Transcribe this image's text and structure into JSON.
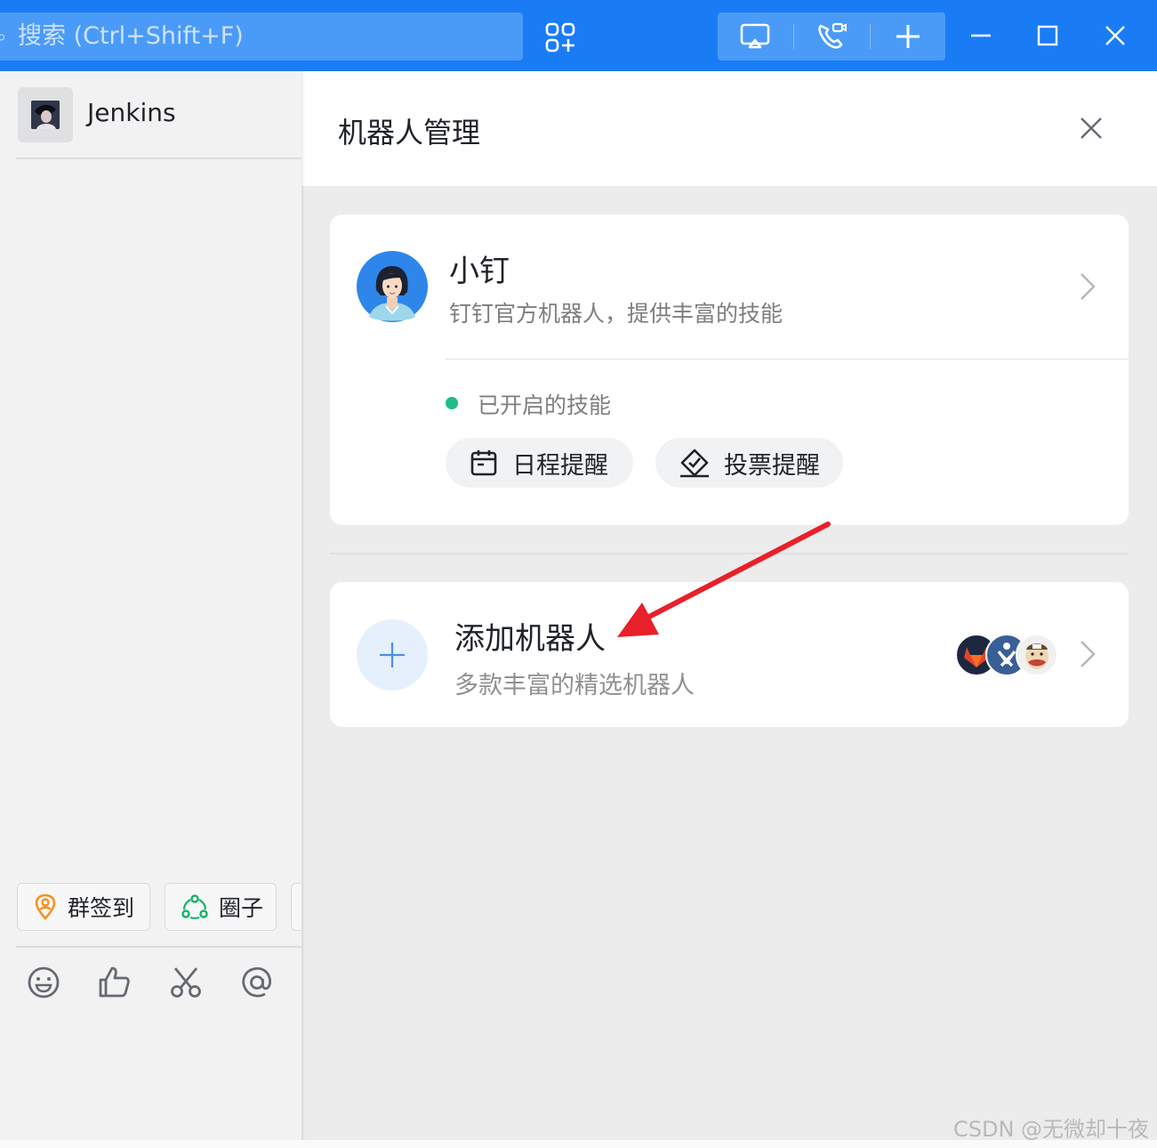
{
  "search": {
    "placeholder": "搜索 (Ctrl+Shift+F)"
  },
  "chat": {
    "name": "Jenkins"
  },
  "quick_actions": [
    {
      "label": "群签到",
      "icon": "location-pin-icon"
    },
    {
      "label": "圈子",
      "icon": "circle-group-icon"
    }
  ],
  "tools": [
    "emoji-icon",
    "thumbs-up-icon",
    "scissors-icon",
    "at-icon"
  ],
  "panel": {
    "title": "机器人管理",
    "official_bot": {
      "name": "小钉",
      "description": "钉钉官方机器人，提供丰富的技能",
      "skills_label": "已开启的技能",
      "skills": [
        {
          "label": "日程提醒",
          "icon": "calendar-icon"
        },
        {
          "label": "投票提醒",
          "icon": "vote-icon"
        }
      ]
    },
    "add_bot": {
      "title": "添加机器人",
      "description": "多款丰富的精选机器人"
    }
  },
  "colors": {
    "titlebar": "#1a7cf5",
    "status_dot": "#1fbd87",
    "annotation_arrow": "#e8202a"
  },
  "watermark": "CSDN @无微却十夜"
}
